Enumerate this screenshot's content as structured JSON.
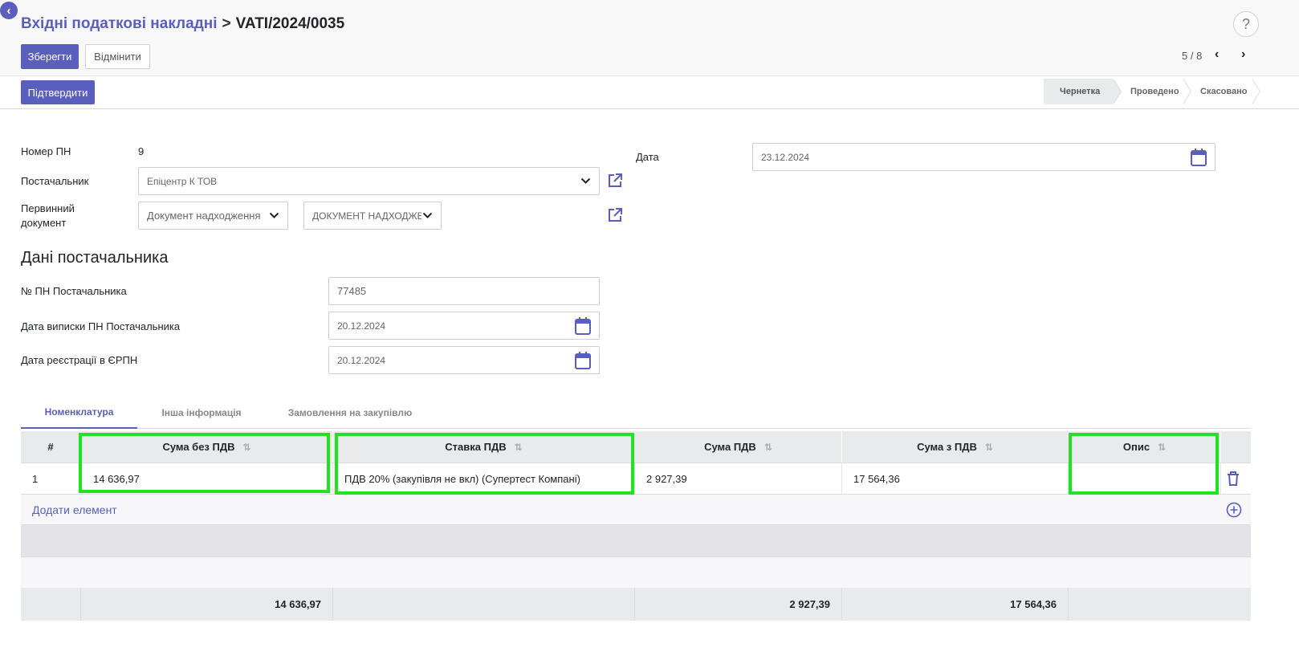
{
  "breadcrumb": {
    "parent": "Вхідні податкові накладні",
    "separator": ">",
    "current": "VATI/2024/0035"
  },
  "help_label": "?",
  "toolbar": {
    "save_label": "Зберегти",
    "discard_label": "Відмінити"
  },
  "pager": {
    "value": "5 / 8"
  },
  "status_bar": {
    "confirm_label": "Підтвердити",
    "steps": [
      "Чернетка",
      "Проведено",
      "Скасовано"
    ],
    "active_step": "Чернетка"
  },
  "form": {
    "number_label": "Номер ПН",
    "number_value": "9",
    "supplier_label": "Постачальник",
    "supplier_value": "Епіцентр К ТОВ",
    "primary_doc_label_1": "Первинний",
    "primary_doc_label_2": "документ",
    "primary_doc_type": "Документ надходження",
    "primary_doc_number": "ДОКУМЕНТ НАДХОДЖЕ",
    "date_label": "Дата",
    "date_value": "23.12.2024"
  },
  "supplier_section": {
    "title": "Дані постачальника",
    "vat_no_label": "№ ПН Постачальника",
    "vat_no_value": "77485",
    "issue_date_label": "Дата виписки ПН Постачальника",
    "issue_date_value": "20.12.2024",
    "reg_date_label": "Дата реєстрації в ЄРПН",
    "reg_date_value": "20.12.2024"
  },
  "tabs": [
    {
      "label": "Номенклатура",
      "active": true
    },
    {
      "label": "Інша інформація",
      "active": false
    },
    {
      "label": "Замовлення на закупівлю",
      "active": false
    }
  ],
  "table": {
    "columns": [
      "#",
      "Сума без ПДВ",
      "Ставка ПДВ",
      "Сума ПДВ",
      "Сума з ПДВ",
      "Опис"
    ],
    "rows": [
      {
        "num": "1",
        "amount_excl": "14 636,97",
        "vat_rate": "ПДВ 20% (закупівля не вкл) (Супертест Компані)",
        "vat_amount": "2 927,39",
        "amount_incl": "17 564,36",
        "description": ""
      }
    ],
    "add_label": "Додати елемент",
    "totals": {
      "amount_excl": "14 636,97",
      "vat_amount": "2 927,39",
      "amount_incl": "17 564,36"
    }
  },
  "colors": {
    "primary": "#5a5ebd",
    "highlight": "#1ee31e"
  }
}
